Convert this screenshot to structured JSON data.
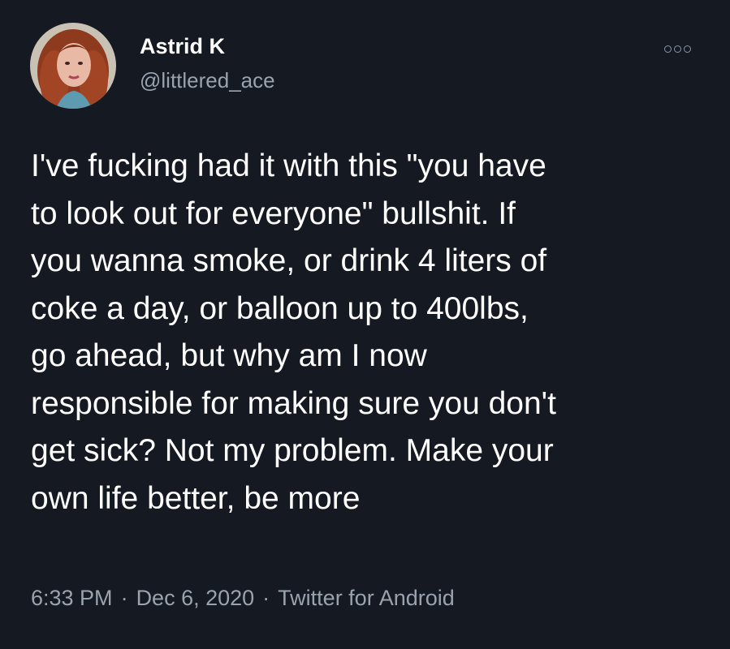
{
  "user": {
    "display_name": "Astrid K",
    "handle": "@littlered_ace"
  },
  "icons": {
    "more": "more-options-icon",
    "avatar": "profile-photo"
  },
  "tweet": {
    "lines": [
      "I've fucking had it with this \"you have",
      "to look out for everyone\" bullshit. If",
      "you wanna smoke, or drink 4 liters of",
      "coke a day, or balloon up to 400lbs,",
      "go ahead, but why am I now",
      "responsible for making sure you don't",
      "get sick? Not my problem. Make your",
      "own life better, be more"
    ],
    "time": "6:33 PM",
    "date": "Dec 6, 2020",
    "source": "Twitter for Android",
    "separator": "·"
  },
  "colors": {
    "background": "#151a22",
    "text": "#ffffff",
    "secondary_text": "#9aa3ad"
  }
}
